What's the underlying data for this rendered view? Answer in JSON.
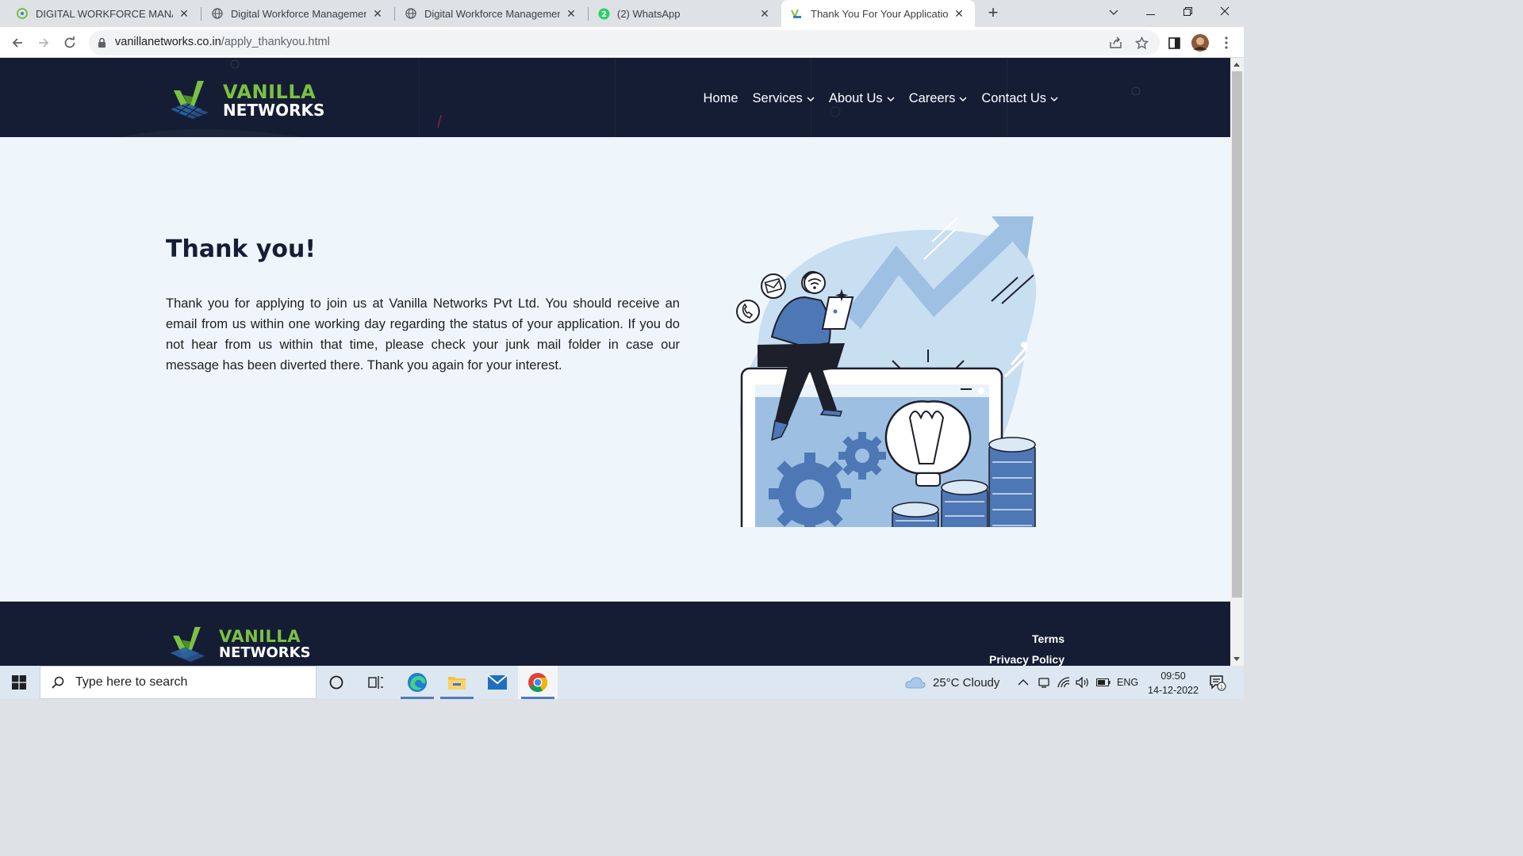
{
  "browser": {
    "tabs": [
      {
        "title": "DIGITAL WORKFORCE MANAGEMEN",
        "active": false
      },
      {
        "title": "Digital Workforce Management S",
        "active": false
      },
      {
        "title": "Digital Workforce Management S",
        "active": false
      },
      {
        "title": "(2) WhatsApp",
        "active": false,
        "badge": "2"
      },
      {
        "title": "Thank You For Your Application",
        "active": true
      }
    ],
    "url_host": "vanillanetworks.co.in",
    "url_path": "/apply_thankyou.html"
  },
  "site": {
    "logo": {
      "line1": "VANILLA",
      "line2": "NETWORKS"
    },
    "nav": [
      {
        "label": "Home",
        "dropdown": false
      },
      {
        "label": "Services",
        "dropdown": true
      },
      {
        "label": "About Us",
        "dropdown": true
      },
      {
        "label": "Careers",
        "dropdown": true
      },
      {
        "label": "Contact Us",
        "dropdown": true
      }
    ],
    "heading": "Thank you!",
    "message": "Thank you for applying to join us at Vanilla Networks Pvt Ltd. You should receive an email from us within one working day regarding the status of your application. If you do not hear from us within that time, please check your junk mail folder in case our message has been diverted there. Thank you again for your interest.",
    "footer": {
      "links": [
        "Terms",
        "Privacy Policy"
      ]
    }
  },
  "taskbar": {
    "search_placeholder": "Type here to search",
    "weather": "25°C  Cloudy",
    "language": "ENG",
    "time": "09:50",
    "date": "14-12-2022",
    "notification_count": "1"
  },
  "colors": {
    "header_bg": "#151d35",
    "page_bg": "#eef6fb",
    "logo_green": "#7cc142",
    "illustration_blue": "#4d78b5"
  }
}
